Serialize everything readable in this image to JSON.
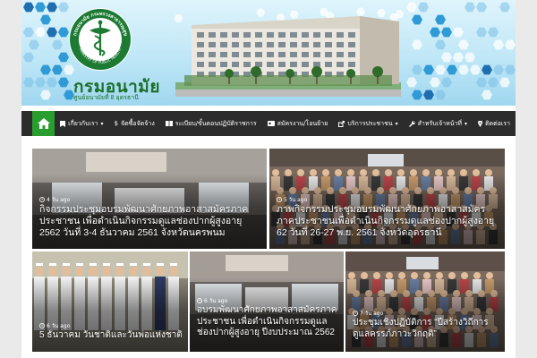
{
  "header": {
    "logo_ring_text": "กรมอนามัย กระทรวงสาธารณสุข",
    "logo_ring_en": "MINISTRY OF PUBLIC HEALTH",
    "site_title": "กรมอนามัย",
    "site_subtitle": "ศูนย์อนามัยที่ 8 อุดรธานี"
  },
  "nav": {
    "items": [
      {
        "label": "เกี่ยวกับเรา",
        "icon": "bookmark-icon",
        "has_menu": true
      },
      {
        "label": "จัดซื้อจัดจ้าง",
        "icon": "dollar-icon",
        "has_menu": false
      },
      {
        "label": "ระเบียบ/ขั้นตอนปฏิบัติราชการ",
        "icon": "book-icon",
        "has_menu": false
      },
      {
        "label": "สมัครงาน/โอนย้าย",
        "icon": "id-card-icon",
        "has_menu": false
      },
      {
        "label": "บริการประชาชน",
        "icon": "external-link-icon",
        "has_menu": true
      },
      {
        "label": "สำหรับเจ้าหน้าที่",
        "icon": "wrench-icon",
        "has_menu": true
      },
      {
        "label": "ติดต่อเรา",
        "icon": "map-marker-icon",
        "has_menu": false
      }
    ]
  },
  "posts": [
    {
      "date": "4 วัน ago",
      "title": "กิจกรรมประชุมอบรมพัฒนาศักยภาพอาสาสมัครภาคประชาชน เพื่อดำเนินกิจกรรมดูแลช่องปากผู้สูงอายุ 2562 วันที่ 3-4 ธันวาคม 2561 จังหวัดนครพนม"
    },
    {
      "date": "5 วัน ago",
      "title": "ภาพกิจกรรมประชุมอบรมพัฒนาศักยภาพอาสาสมัครภาคประชาชนเพื่อดำเนินกิจกรรมดูแลช่องปากผู้สูงอายุ 62 วันที่ 26-27 พ.ย. 2561 จังหวัดอุดรธานี"
    },
    {
      "date": "6 วัน ago",
      "title": "5 ธันวาคม วันชาติและวันพ่อแห่งชาติ"
    },
    {
      "date": "6 วัน ago",
      "title": "อบรมพัฒนาศักยภาพอาสาสมัครภาคประชาชน เพื่อดำเนินกิจกรรมดูแลช่องปากผู้สูงอายุ ปีงบประมาณ 2562"
    },
    {
      "date": "7 วัน ago",
      "title": "ประชุมเชิงปฏิบัติการ “ปีสร้างวิถีการดูแลครรภ์ภาวะวิกฤติ”"
    }
  ],
  "colors": {
    "nav_bg": "#2c2c2c",
    "nav_home": "#2a9d2f",
    "brand_green": "#1b6f2a"
  }
}
